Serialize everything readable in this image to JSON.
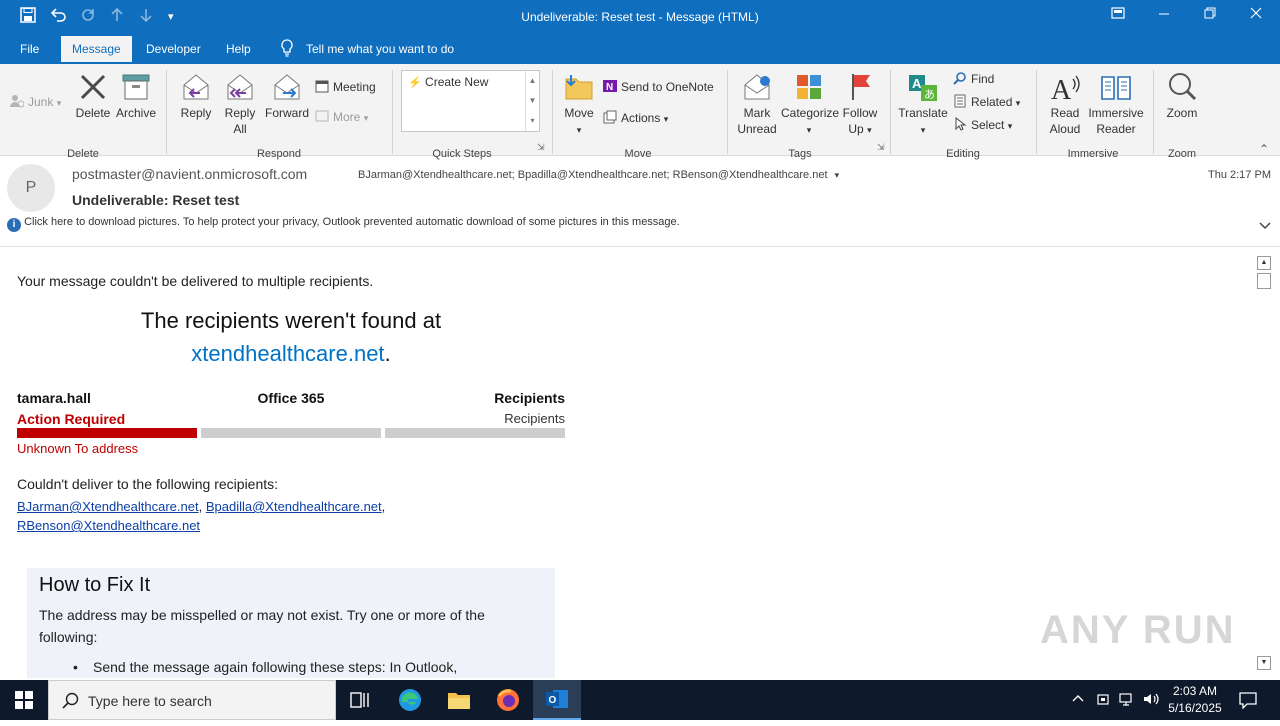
{
  "window": {
    "title": "Undeliverable: Reset test  -  Message (HTML)"
  },
  "tabs": [
    "File",
    "Message",
    "Developer",
    "Help"
  ],
  "tell_me": "Tell me what you want to do",
  "ribbon": {
    "junk": "Junk",
    "delete": "Delete",
    "archive": "Archive",
    "reply": "Reply",
    "reply_all": [
      "Reply",
      "All"
    ],
    "forward": "Forward",
    "meeting": "Meeting",
    "more": "More",
    "create_new": "Create New",
    "move": "Move",
    "send_onenote": "Send to OneNote",
    "actions": "Actions",
    "mark_unread": [
      "Mark",
      "Unread"
    ],
    "categorize": "Categorize",
    "follow_up": [
      "Follow",
      "Up"
    ],
    "translate": "Translate",
    "find": "Find",
    "related": "Related",
    "select": "Select",
    "read_aloud": [
      "Read",
      "Aloud"
    ],
    "immersive_reader": [
      "Immersive",
      "Reader"
    ],
    "zoom": "Zoom",
    "groups": [
      "Delete",
      "Respond",
      "Quick Steps",
      "Move",
      "Tags",
      "Editing",
      "Immersive",
      "Zoom"
    ]
  },
  "header": {
    "avatar_letter": "P",
    "from": "postmaster@navient.onmicrosoft.com",
    "to": "BJarman@Xtendhealthcare.net; Bpadilla@Xtendhealthcare.net; RBenson@Xtendhealthcare.net",
    "subject": "Undeliverable: Reset test",
    "time": "Thu 2:17 PM",
    "info": "Click here to download pictures. To help protect your privacy, Outlook prevented automatic download of some pictures in this message."
  },
  "body": {
    "intro": "Your message couldn't be delivered to multiple recipients.",
    "headline1": "The recipients weren't found at",
    "headline_domain": "xtendhealthcare.net",
    "headline_dot": ".",
    "col1_name": "tamara.hall",
    "col1_status": "Action Required",
    "col2_name": "Office 365",
    "col3_name": "Recipients",
    "col3_status": "Recipients",
    "unknown": "Unknown To address",
    "couldnt": "Couldn't deliver to the following recipients:",
    "recipients": [
      "BJarman@Xtendhealthcare.net",
      "Bpadilla@Xtendhealthcare.net",
      "RBenson@Xtendhealthcare.net"
    ],
    "fix_title": "How to Fix It",
    "fix_text": "The address may be misspelled or may not exist. Try one or more of the following:",
    "fix_bullet": "Send the message again following these steps: In Outlook,"
  },
  "watermark": "ANY RUN",
  "taskbar": {
    "search_placeholder": "Type here to search",
    "time": "2:03 AM",
    "date": "5/16/2025"
  },
  "colors": {
    "accent": "#106ebe",
    "error_red": "#c00000",
    "link_blue": "#0072c6"
  }
}
